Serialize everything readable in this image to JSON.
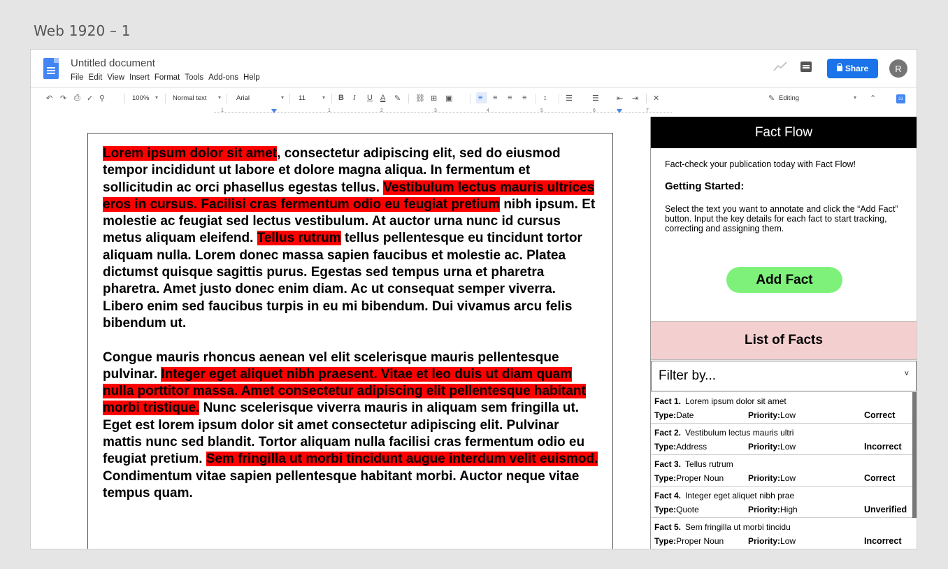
{
  "frame_label": "Web 1920 – 1",
  "header": {
    "doc_title": "Untitled document",
    "menu": [
      "File",
      "Edit",
      "View",
      "Insert",
      "Format",
      "Tools",
      "Add-ons",
      "Help"
    ],
    "share_label": "Share",
    "avatar_initial": "R"
  },
  "toolbar": {
    "zoom": "100%",
    "style": "Normal text",
    "font": "Arial",
    "font_size": "11",
    "mode": "Editing"
  },
  "ruler": [
    "1",
    "1",
    "2",
    "3",
    "4",
    "5",
    "6",
    "7"
  ],
  "calendar_label": "31",
  "document": {
    "p1": [
      {
        "text": "Lorem ipsum dolor sit amet",
        "hl": true
      },
      {
        "text": ", consectetur adipiscing elit, sed do eiusmod tempor incididunt ut labore et dolore magna aliqua. In fermentum et sollicitudin ac orci phasellus egestas tellus. ",
        "hl": false
      },
      {
        "text": "Vestibulum lectus mauris ultrices eros in cursus. Facilisi cras fermentum odio eu feugiat pretium",
        "hl": true
      },
      {
        "text": " nibh ipsum. Et molestie ac feugiat sed lectus vestibulum. At auctor urna nunc id cursus metus aliquam eleifend. ",
        "hl": false
      },
      {
        "text": "Tellus rutrum",
        "hl": true
      },
      {
        "text": " tellus pellentesque eu tincidunt tortor aliquam nulla. Lorem donec massa sapien faucibus et molestie ac. Platea dictumst quisque sagittis purus. Egestas sed tempus urna et pharetra pharetra. Amet justo donec enim diam. Ac ut consequat semper viverra. Libero enim sed faucibus turpis in eu mi bibendum. Dui vivamus arcu felis bibendum ut.",
        "hl": false
      }
    ],
    "p2": [
      {
        "text": "Congue mauris rhoncus aenean vel elit scelerisque mauris pellentesque pulvinar. ",
        "hl": false
      },
      {
        "text": "Integer eget aliquet nibh praesent. Vitae et leo duis ut diam quam nulla porttitor massa. Amet consectetur adipiscing elit pellentesque habitant morbi tristique.",
        "hl": true
      },
      {
        "text": " Nunc scelerisque viverra mauris in aliquam sem fringilla ut. Eget est lorem ipsum dolor sit amet consectetur adipiscing elit. Pulvinar mattis nunc sed blandit. Tortor aliquam nulla facilisi cras fermentum odio eu feugiat pretium. ",
        "hl": false
      },
      {
        "text": "Sem fringilla ut morbi tincidunt augue interdum velit euismod.",
        "hl": true
      },
      {
        "text": " Condimentum vitae sapien pellentesque habitant morbi. Auctor neque vitae tempus quam.",
        "hl": false
      }
    ]
  },
  "panel": {
    "title": "Fact Flow",
    "intro": "Fact-check your publication today with Fact Flow!",
    "getting_started": "Getting Started:",
    "instructions": "Select the text you want to annotate and click the “Add Fact” button. Input the key details for each fact to start tracking, correcting and assigning them.",
    "add_fact_label": "Add Fact",
    "list_title": "List of Facts",
    "filter_label": "Filter by...",
    "type_label": "Type:",
    "priority_label": "Priority:",
    "facts": [
      {
        "num": "Fact 1.",
        "title": "Lorem ipsum dolor sit amet",
        "type": "Date",
        "priority": "Low",
        "status": "Correct"
      },
      {
        "num": "Fact 2.",
        "title": "Vestibulum lectus mauris ultri",
        "type": "Address",
        "priority": "Low",
        "status": "Incorrect"
      },
      {
        "num": "Fact 3.",
        "title": "Tellus rutrum",
        "type": "Proper Noun",
        "priority": "Low",
        "status": "Correct"
      },
      {
        "num": "Fact 4.",
        "title": "Integer eget aliquet nibh prae",
        "type": "Quote",
        "priority": "High",
        "status": "Unverified"
      },
      {
        "num": "Fact 5.",
        "title": "Sem fringilla ut morbi tincidu",
        "type": "Proper Noun",
        "priority": "Low",
        "status": "Incorrect"
      }
    ]
  },
  "colors": {
    "highlight": "#ff0000",
    "share_blue": "#1a73e8",
    "add_fact_green": "#7ef17a",
    "list_header_pink": "#f4cfcf"
  }
}
